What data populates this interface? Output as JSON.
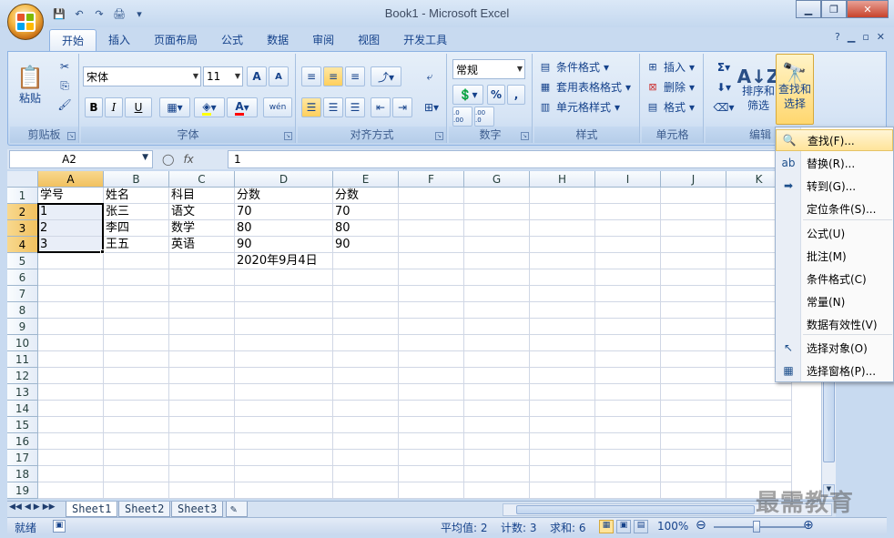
{
  "window": {
    "title": "Book1 - Microsoft Excel",
    "minimize": "▁",
    "restore": "❐",
    "close": "✕"
  },
  "qat": {
    "save": "💾",
    "undo": "↶",
    "redo": "↷",
    "print_preview": "🖨",
    "customize": "▾"
  },
  "tabs": [
    "开始",
    "插入",
    "页面布局",
    "公式",
    "数据",
    "审阅",
    "视图",
    "开发工具"
  ],
  "active_tab": "开始",
  "right_ctrls": {
    "help": "?",
    "min": "▁",
    "restore": "▫",
    "close": "✕"
  },
  "ribbon": {
    "clipboard": {
      "label": "剪贴板",
      "paste": "粘贴"
    },
    "font": {
      "label": "字体",
      "font_name": "宋体",
      "font_size": "11",
      "bold": "B",
      "italic": "I",
      "underline": "U",
      "grow": "A",
      "shrink": "A",
      "wen": "wén",
      "font_color_letter": "A"
    },
    "alignment": {
      "label": "对齐方式"
    },
    "number": {
      "label": "数字",
      "format": "常规",
      "percent": "%",
      "comma": ",",
      "inc_dec": ".0 .00",
      "dec_dec": ".00 .0"
    },
    "styles": {
      "label": "样式",
      "conditional": "条件格式",
      "table": "套用表格格式",
      "cell_styles": "单元格样式"
    },
    "cells": {
      "label": "单元格",
      "insert": "插入",
      "delete": "删除",
      "format": "格式"
    },
    "editing": {
      "label": "编辑",
      "sum": "Σ",
      "sort_filter_1": "排序和",
      "sort_filter_2": "筛选",
      "find_select_1": "查找和",
      "find_select_2": "选择"
    }
  },
  "formula_bar": {
    "name_box": "A2",
    "fx": "fx",
    "formula": "1"
  },
  "columns": [
    "A",
    "B",
    "C",
    "D",
    "E",
    "F",
    "G",
    "H",
    "I",
    "J",
    "K"
  ],
  "rows": [
    "1",
    "2",
    "3",
    "4",
    "5",
    "6",
    "7",
    "8",
    "9",
    "10",
    "11",
    "12",
    "13",
    "14",
    "15",
    "16",
    "17",
    "18",
    "19"
  ],
  "cells": {
    "A1": "学号",
    "B1": "姓名",
    "C1": "科目",
    "D1": "分数",
    "E1": "分数",
    "A2": "1",
    "B2": "张三",
    "C2": "语文",
    "D2": "70",
    "E2": "70",
    "A3": "2",
    "B3": "李四",
    "C3": "数学",
    "D3": "80",
    "E3": "80",
    "A4": "3",
    "B4": "王五",
    "C4": "英语",
    "D4": "90",
    "E4": "90",
    "D5": "2020年9月4日"
  },
  "sheets": [
    "Sheet1",
    "Sheet2",
    "Sheet3"
  ],
  "active_sheet": "Sheet1",
  "sheet_nav": [
    "◀◀",
    "◀",
    "▶",
    "▶▶"
  ],
  "status": {
    "ready": "就绪",
    "average": "平均值: 2",
    "count": "计数: 3",
    "sum": "求和: 6",
    "zoom": "100%",
    "zoom_out": "⊖",
    "zoom_in": "⊕"
  },
  "find_menu": [
    {
      "label": "查找(F)...",
      "icon": "binoculars-icon",
      "glyph": "🔍"
    },
    {
      "label": "替换(R)...",
      "icon": "replace-icon",
      "glyph": "ab"
    },
    {
      "label": "转到(G)...",
      "icon": "arrow-right-icon",
      "glyph": "➡"
    },
    {
      "label": "定位条件(S)...",
      "icon": "",
      "glyph": ""
    },
    {
      "label": "公式(U)",
      "icon": "",
      "glyph": ""
    },
    {
      "label": "批注(M)",
      "icon": "",
      "glyph": ""
    },
    {
      "label": "条件格式(C)",
      "icon": "",
      "glyph": ""
    },
    {
      "label": "常量(N)",
      "icon": "",
      "glyph": ""
    },
    {
      "label": "数据有效性(V)",
      "icon": "",
      "glyph": ""
    },
    {
      "label": "选择对象(O)",
      "icon": "pointer-icon",
      "glyph": "↖"
    },
    {
      "label": "选择窗格(P)...",
      "icon": "selection-pane-icon",
      "glyph": "▦"
    }
  ],
  "watermark": "最需教育",
  "colors": {
    "ribbon_bg": "#d6e4f5",
    "accent": "#15428b",
    "highlight": "#ffe49a"
  }
}
